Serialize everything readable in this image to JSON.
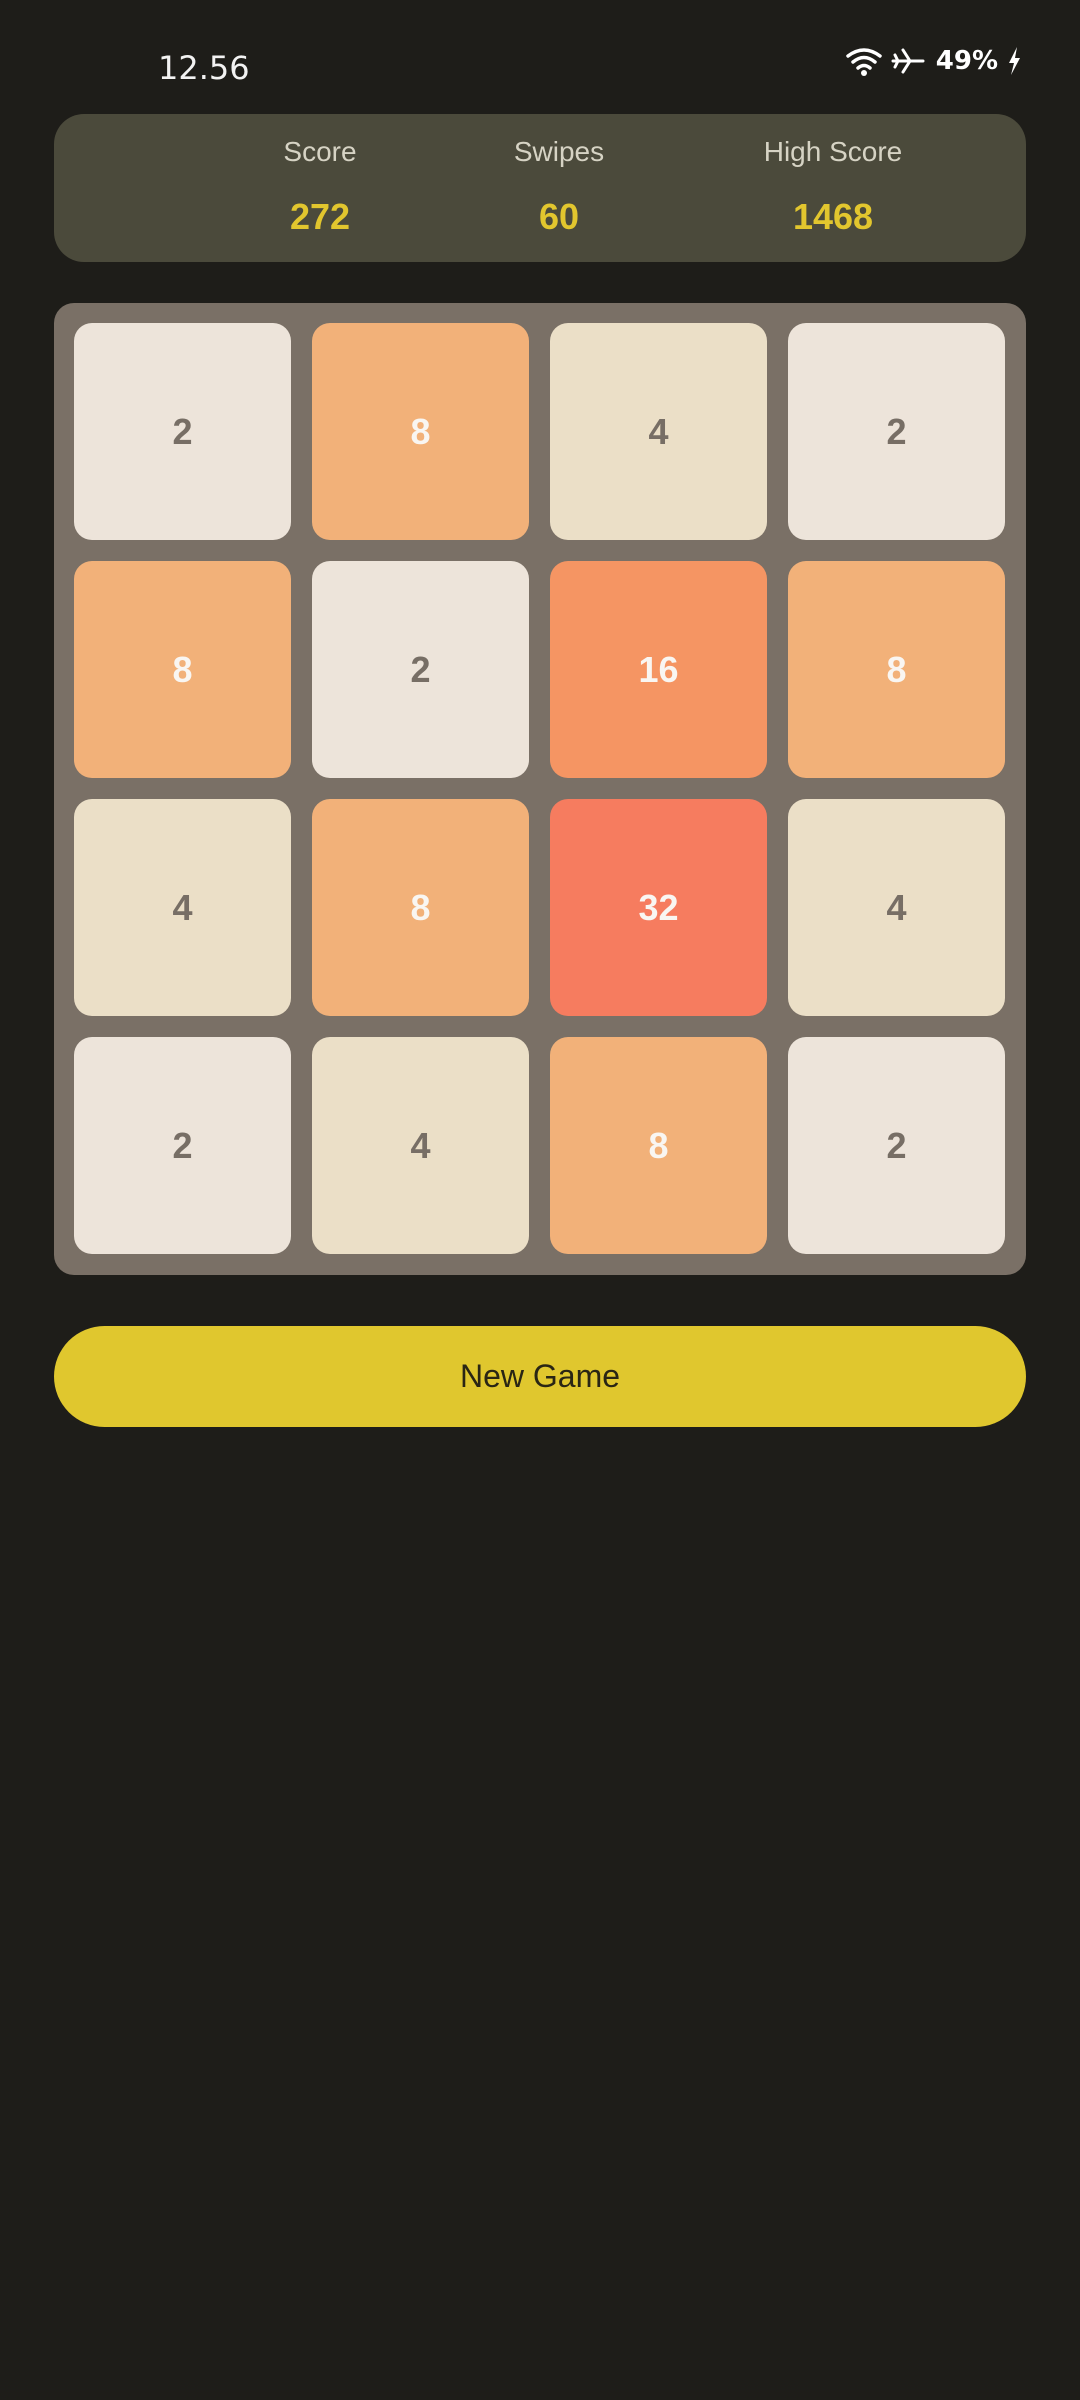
{
  "status_bar": {
    "time": "12.56",
    "battery": "49%",
    "icons": [
      "wifi-icon",
      "airplane-mode-icon",
      "charging-icon"
    ]
  },
  "scoreboard": {
    "score_label": "Score",
    "score_value": "272",
    "swipes_label": "Swipes",
    "swipes_value": "60",
    "high_score_label": "High Score",
    "high_score_value": "1468"
  },
  "board": {
    "rows": [
      [
        2,
        8,
        4,
        2
      ],
      [
        8,
        2,
        16,
        8
      ],
      [
        4,
        8,
        32,
        4
      ],
      [
        2,
        4,
        8,
        2
      ]
    ],
    "tile_colors": {
      "2": {
        "bg": "#ede4da",
        "fg": "#776e65"
      },
      "4": {
        "bg": "#ebdfc7",
        "fg": "#776e65"
      },
      "8": {
        "bg": "#f2b179",
        "fg": "#f9f6f2"
      },
      "16": {
        "bg": "#f59563",
        "fg": "#f9f6f2"
      },
      "32": {
        "bg": "#f67c5f",
        "fg": "#f9f6f2"
      }
    }
  },
  "actions": {
    "new_game_label": "New Game"
  },
  "colors": {
    "background": "#1e1d19",
    "panel": "#4b4a3b",
    "board": "#7a7066",
    "accent": "#e0c72e"
  }
}
